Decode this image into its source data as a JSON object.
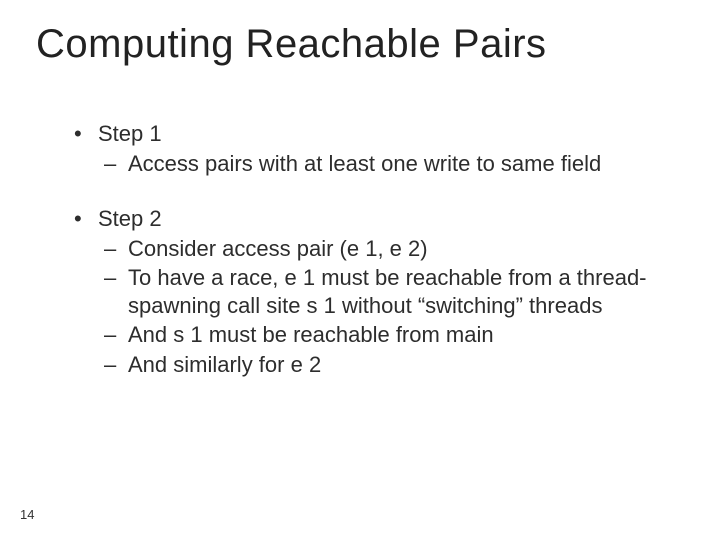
{
  "slide": {
    "title": "Computing Reachable Pairs",
    "page_number": "14",
    "bullets": [
      {
        "label": "Step 1",
        "sub": [
          "Access pairs with at least one write to same field"
        ]
      },
      {
        "label": "Step 2",
        "sub": [
          "Consider access pair (e 1, e 2)",
          "To have a race, e 1 must be reachable from a thread-spawning call site s 1 without “switching” threads",
          "And s 1 must be reachable from main",
          "And similarly for e 2"
        ]
      }
    ]
  }
}
